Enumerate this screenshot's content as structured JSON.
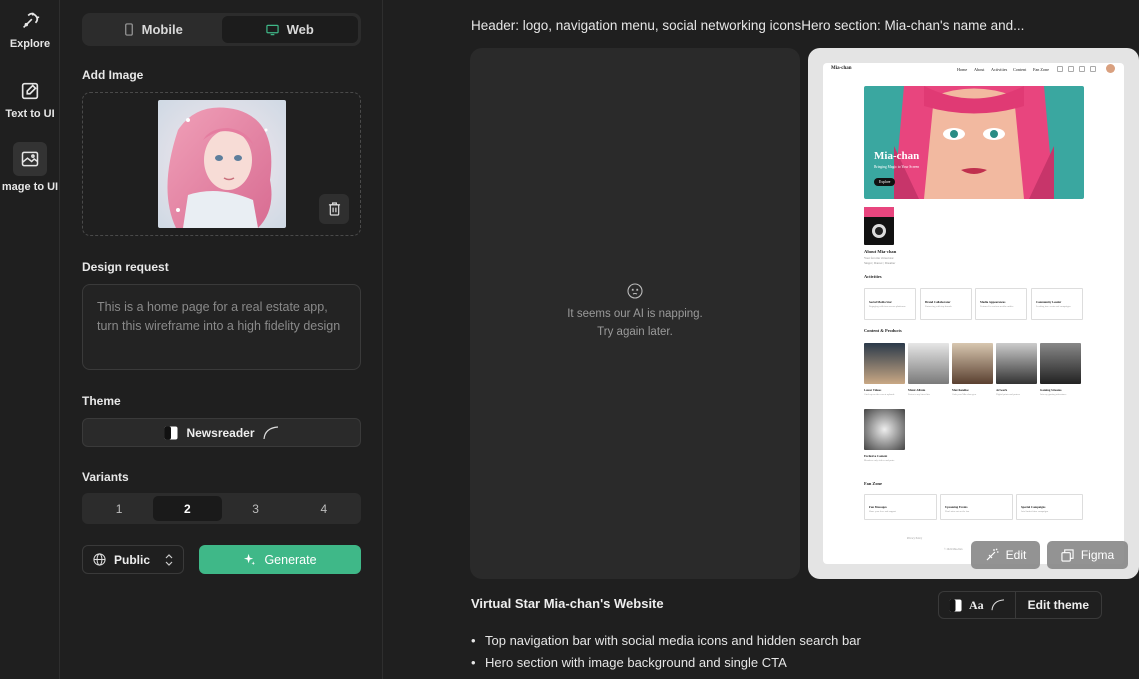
{
  "rail": {
    "items": [
      {
        "label": "Explore",
        "icon": "explore-icon"
      },
      {
        "label": "Text to UI",
        "icon": "edit-icon"
      },
      {
        "label": "mage to UI",
        "icon": "image-icon"
      }
    ]
  },
  "panel": {
    "device_tabs": {
      "mobile": "Mobile",
      "web": "Web",
      "selected": "Web"
    },
    "add_image_label": "Add Image",
    "design_request_label": "Design request",
    "design_request_placeholder": "This is a home page for a real estate app, turn this wireframe into a high fidelity design",
    "theme_label": "Theme",
    "theme_value": "Newsreader",
    "variants_label": "Variants",
    "variants": [
      "1",
      "2",
      "3",
      "4"
    ],
    "variant_selected": "2",
    "visibility": "Public",
    "generate_label": "Generate"
  },
  "main": {
    "header_text": "Header: logo, navigation menu, social networking iconsHero section: Mia-chan's name and...",
    "error_line1": "It seems our AI is napping.",
    "error_line2": "Try again later.",
    "edit_label": "Edit",
    "figma_label": "Figma",
    "title": "Virtual Star Mia-chan's Website",
    "theme_font_sample": "Aa",
    "edit_theme_label": "Edit theme",
    "bullets": [
      "Top navigation bar with social media icons and hidden search bar",
      "Hero section with image background and single CTA"
    ]
  },
  "preview": {
    "brand": "Mia-chan",
    "nav": [
      "Home",
      "About",
      "Activities",
      "Content",
      "Fan Zone"
    ],
    "hero_title": "Mia-chan",
    "hero_subtitle": "Bringing Magic to Your Screen",
    "hero_cta": "Explore",
    "about_title": "About Mia-chan",
    "about_line1": "Your favorite virtual star",
    "about_line2": "Singer | Dancer | Dreamer",
    "activities_title": "Activities",
    "activities": [
      {
        "title": "Social Media Star",
        "desc": "Engaging with fans across platforms"
      },
      {
        "title": "Brand Collaborator",
        "desc": "Partnering with top brands"
      },
      {
        "title": "Media Appearances",
        "desc": "Featured in various media outlets"
      },
      {
        "title": "Community Leader",
        "desc": "Leading fan events and campaigns"
      }
    ],
    "content_title": "Content & Products",
    "content": [
      {
        "title": "Latest Videos",
        "desc": "Catch up on the newest uploads"
      },
      {
        "title": "Music Album",
        "desc": "Listen to my latest hits"
      },
      {
        "title": "Merchandise",
        "desc": "Grab your Mia-chan gear"
      },
      {
        "title": "Artwork",
        "desc": "Digital prints and posters"
      },
      {
        "title": "Gaming Streams",
        "desc": "Join my gaming adventures"
      },
      {
        "title": "Exclusive Content",
        "desc": "Members only videos and posts"
      }
    ],
    "fanzone_title": "Fan Zone",
    "fanzone": [
      {
        "title": "Fan Messages",
        "desc": "Share your love and support"
      },
      {
        "title": "Upcoming Events",
        "desc": "Don't miss out on the fun"
      },
      {
        "title": "Special Campaigns",
        "desc": "Join limited-time campaigns"
      }
    ],
    "footer_link": "Privacy Policy",
    "footer_copy": "© 2024 Mia-chan"
  },
  "colors": {
    "accent": "#3fb888",
    "hero_pink": "#e8457e",
    "hero_teal": "#2c9c9c"
  }
}
